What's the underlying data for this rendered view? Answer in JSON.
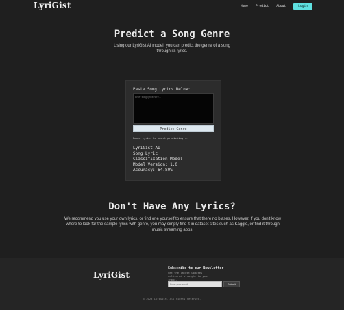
{
  "nav": {
    "logo": "LyriGist",
    "links": [
      "Home",
      "Predict",
      "About"
    ],
    "login": "Login"
  },
  "hero": {
    "title": "Predict a Song Genre",
    "subtitle": "Using our LyriGist AI model, you can predict the genre of a song through its lyrics."
  },
  "predict_card": {
    "label": "Paste Song Lyrics Below:",
    "placeholder": "Enter song lyrics here...",
    "button": "Predict Genre",
    "status": "Paste lyrics to start predicting...",
    "model_name": "LyriGist AI",
    "model_desc_1": "Song Lyric",
    "model_desc_2": "Classification Model",
    "model_version": "Model Version: 1.0",
    "accuracy": "Accuracy: 64.80%"
  },
  "no_lyrics": {
    "title": "Don't Have Any Lyrics?",
    "text": "We recommend you use your own lyrics, or find one yourself to ensure that there no biases. However, if you don't know where to look for the sample lyrics with genre, you may simply find it in dataset sites such as Kaggle, or find it through music streaming apps."
  },
  "footer": {
    "logo": "LyriGist",
    "newsletter_title": "Subscribe to our Newsletter",
    "newsletter_desc": "Get the latest updates delivered straight to your inbox.",
    "email_placeholder": "Enter your email",
    "submit": "Submit",
    "copyright": "© 2023 LyriGist. All rights reserved."
  },
  "colors": {
    "background": "#1f1f1f",
    "accent": "#5fe0e0",
    "card": "#2c2c2c"
  }
}
